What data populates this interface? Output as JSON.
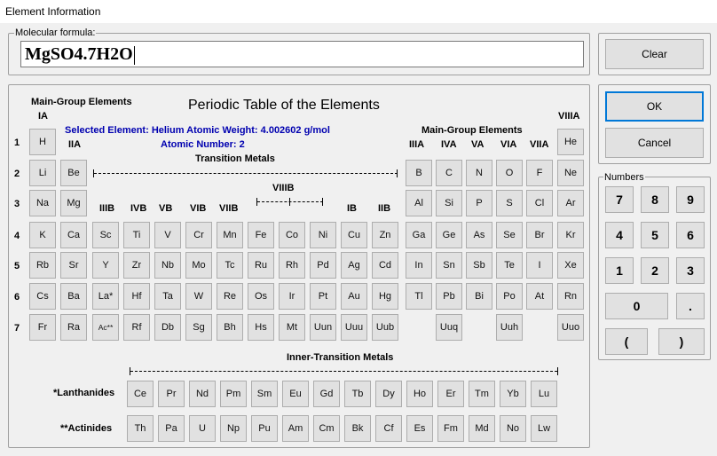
{
  "window": {
    "title": "Element Information"
  },
  "formula": {
    "legend": "Molecular formula:",
    "value": "MgSO4.7H2O"
  },
  "buttons": {
    "clear": "Clear",
    "ok": "OK",
    "cancel": "Cancel"
  },
  "numbers": {
    "legend": "Numbers",
    "keys": [
      "7",
      "8",
      "9",
      "4",
      "5",
      "6",
      "1",
      "2",
      "3",
      "0",
      ".",
      "(",
      ")"
    ]
  },
  "table": {
    "title": "Periodic Table of the Elements",
    "main_group_left": "Main-Group Elements",
    "main_group_right": "Main-Group Elements",
    "transition_metals": "Transition Metals",
    "inner_transition": "Inner-Transition Metals",
    "selected_line1": "Selected Element:  Helium   Atomic Weight:  4.002602 g/mol",
    "selected_line2": "Atomic Number:  2",
    "groups": [
      "IA",
      "IIA",
      "IIIB",
      "IVB",
      "VB",
      "VIB",
      "VIIB",
      "VIIIB",
      "IB",
      "IIB",
      "IIIA",
      "IVA",
      "VA",
      "VIA",
      "VIIA",
      "VIIIA"
    ],
    "periods": [
      "1",
      "2",
      "3",
      "4",
      "5",
      "6",
      "7"
    ],
    "lanthanides_label": "*Lanthanides",
    "actinides_label": "**Actinides",
    "rows": [
      [
        "H",
        null,
        null,
        null,
        null,
        null,
        null,
        null,
        null,
        null,
        null,
        null,
        null,
        null,
        null,
        null,
        null,
        "He"
      ],
      [
        "Li",
        "Be",
        null,
        null,
        null,
        null,
        null,
        null,
        null,
        null,
        null,
        null,
        "B",
        "C",
        "N",
        "O",
        "F",
        "Ne"
      ],
      [
        "Na",
        "Mg",
        null,
        null,
        null,
        null,
        null,
        null,
        null,
        null,
        null,
        null,
        "Al",
        "Si",
        "P",
        "S",
        "Cl",
        "Ar"
      ],
      [
        "K",
        "Ca",
        "Sc",
        "Ti",
        "V",
        "Cr",
        "Mn",
        "Fe",
        "Co",
        "Ni",
        "Cu",
        "Zn",
        "Ga",
        "Ge",
        "As",
        "Se",
        "Br",
        "Kr"
      ],
      [
        "Rb",
        "Sr",
        "Y",
        "Zr",
        "Nb",
        "Mo",
        "Tc",
        "Ru",
        "Rh",
        "Pd",
        "Ag",
        "Cd",
        "In",
        "Sn",
        "Sb",
        "Te",
        "I",
        "Xe"
      ],
      [
        "Cs",
        "Ba",
        "La*",
        "Hf",
        "Ta",
        "W",
        "Re",
        "Os",
        "Ir",
        "Pt",
        "Au",
        "Hg",
        "Tl",
        "Pb",
        "Bi",
        "Po",
        "At",
        "Rn"
      ],
      [
        "Fr",
        "Ra",
        "Ac**",
        "Rf",
        "Db",
        "Sg",
        "Bh",
        "Hs",
        "Mt",
        "Uun",
        "Uuu",
        "Uub",
        null,
        "Uuq",
        null,
        "Uuh",
        null,
        "Uuo"
      ]
    ],
    "lanthanides": [
      "Ce",
      "Pr",
      "Nd",
      "Pm",
      "Sm",
      "Eu",
      "Gd",
      "Tb",
      "Dy",
      "Ho",
      "Er",
      "Tm",
      "Yb",
      "Lu"
    ],
    "actinides": [
      "Th",
      "Pa",
      "U",
      "Np",
      "Pu",
      "Am",
      "Cm",
      "Bk",
      "Cf",
      "Es",
      "Fm",
      "Md",
      "No",
      "Lw"
    ]
  }
}
